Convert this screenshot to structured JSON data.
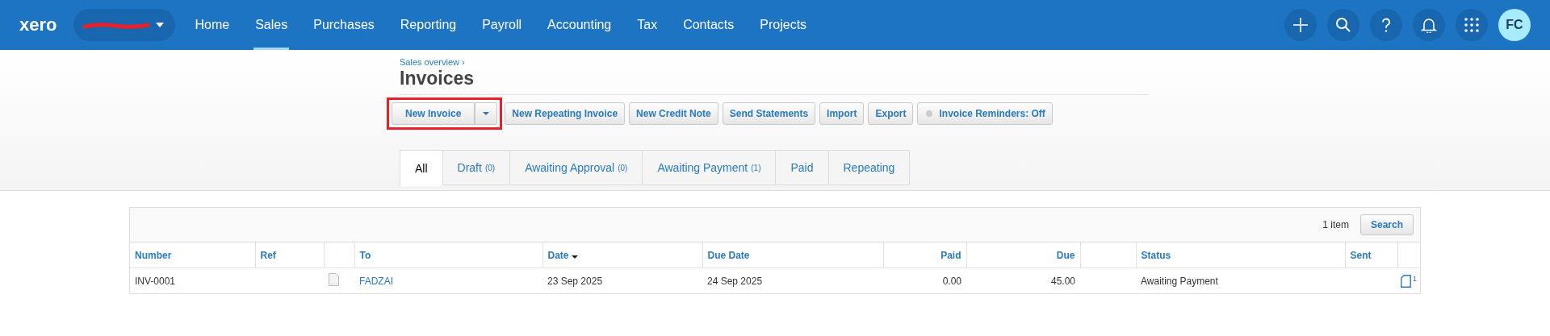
{
  "topnav": {
    "logo": "xero",
    "items": [
      {
        "label": "Home",
        "selected": false
      },
      {
        "label": "Sales",
        "selected": true
      },
      {
        "label": "Purchases",
        "selected": false
      },
      {
        "label": "Reporting",
        "selected": false
      },
      {
        "label": "Payroll",
        "selected": false
      },
      {
        "label": "Accounting",
        "selected": false
      },
      {
        "label": "Tax",
        "selected": false
      },
      {
        "label": "Contacts",
        "selected": false
      },
      {
        "label": "Projects",
        "selected": false
      }
    ],
    "avatar": "FC"
  },
  "breadcrumb": "Sales overview ›",
  "title": "Invoices",
  "actions": [
    {
      "label": "New Invoice",
      "kind": "split",
      "highlighted": true
    },
    {
      "label": "New Repeating Invoice",
      "kind": "plain"
    },
    {
      "label": "New Credit Note",
      "kind": "plain"
    },
    {
      "label": "Send Statements",
      "kind": "plain"
    },
    {
      "label": "Import",
      "kind": "plain"
    },
    {
      "label": "Export",
      "kind": "plain"
    },
    {
      "label": "Invoice Reminders: Off",
      "kind": "toggle",
      "on": false
    }
  ],
  "tabs": [
    {
      "label": "All",
      "selected": true
    },
    {
      "label": "Draft",
      "count": "(0)",
      "selected": false
    },
    {
      "label": "Awaiting Approval",
      "count": "(0)",
      "selected": false
    },
    {
      "label": "Awaiting Payment",
      "count": "(1)",
      "selected": false
    },
    {
      "label": "Paid",
      "selected": false
    },
    {
      "label": "Repeating",
      "selected": false
    }
  ],
  "table": {
    "item_count": "1 item",
    "search_button": "Search",
    "columns": [
      {
        "label": "Number",
        "sorted": false
      },
      {
        "label": "Ref",
        "sorted": false
      },
      {
        "sorted": false
      },
      {
        "label": "To",
        "sorted": false
      },
      {
        "label": "Date",
        "sorted": true
      },
      {
        "label": "Due Date",
        "sorted": false
      },
      {
        "label": "Paid",
        "sorted": false
      },
      {
        "label": "Due",
        "sorted": false
      },
      {
        "sorted": false
      },
      {
        "label": "Status",
        "sorted": false
      },
      {
        "label": "Sent",
        "sorted": false
      },
      {
        "sorted": false
      }
    ],
    "rows": [
      {
        "number": "INV-0001",
        "to": "FADZAI",
        "date": "23 Sep 2025",
        "due_date": "24 Sep 2025",
        "paid": "0.00",
        "due": "45.00",
        "status": "Awaiting Payment",
        "sent_count": "1"
      }
    ]
  }
}
